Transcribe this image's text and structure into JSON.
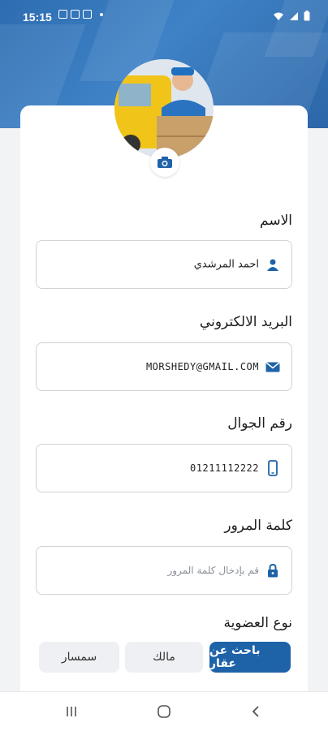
{
  "status_bar": {
    "time": "15:15"
  },
  "profile": {
    "camera_icon": "camera-icon"
  },
  "form": {
    "name": {
      "label": "الاسم",
      "value": "احمد المرشدي"
    },
    "email": {
      "label": "البريد الالكتروني",
      "value": "MORSHEDY@GMAIL.COM"
    },
    "phone": {
      "label": "رقم الجوال",
      "value": "01211112222"
    },
    "password": {
      "label": "كلمة المرور",
      "placeholder": "قم بإدخال كلمة المرور"
    },
    "membership": {
      "label": "نوع العضوية",
      "options": [
        "باحث عن عقار",
        "مالك",
        "سمسار"
      ],
      "selected": "باحث عن عقار"
    }
  },
  "colors": {
    "primary": "#1e63a8",
    "header": "#3f82c6"
  }
}
